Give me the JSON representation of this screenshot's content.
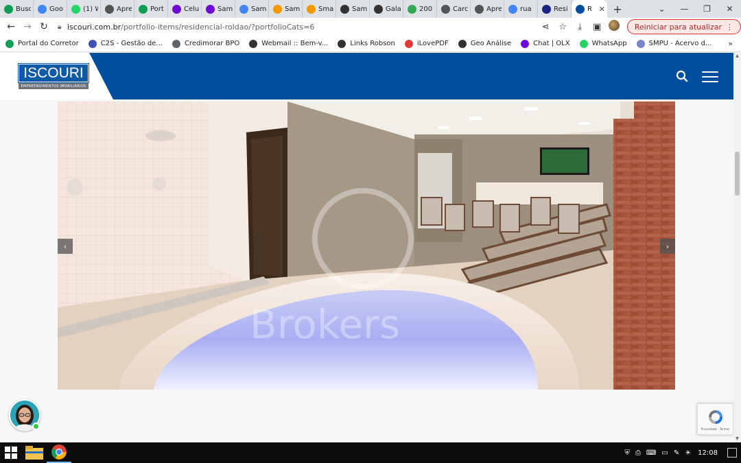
{
  "browser": {
    "tabs": [
      {
        "label": "Busc",
        "icon": "green-circle-icon",
        "color": "#0f9d58"
      },
      {
        "label": "Goo",
        "icon": "google-icon",
        "color": "#4285f4"
      },
      {
        "label": "(1) W",
        "icon": "whatsapp-icon",
        "color": "#25d366"
      },
      {
        "label": "Apre",
        "icon": "globe-icon",
        "color": "#555555"
      },
      {
        "label": "Port",
        "icon": "green-circle-icon",
        "color": "#0f9d58"
      },
      {
        "label": "Celu",
        "icon": "olx-icon",
        "color": "#6e0ad6"
      },
      {
        "label": "Sam",
        "icon": "olx-icon",
        "color": "#6e0ad6"
      },
      {
        "label": "Sam",
        "icon": "google-icon",
        "color": "#4285f4"
      },
      {
        "label": "Sam",
        "icon": "orange-circle-icon",
        "color": "#f29900"
      },
      {
        "label": "Sma",
        "icon": "orange-circle-icon",
        "color": "#f29900"
      },
      {
        "label": "Sam",
        "icon": "gc-icon",
        "color": "#333333"
      },
      {
        "label": "Gala",
        "icon": "gc-icon",
        "color": "#333333"
      },
      {
        "label": "200",
        "icon": "map-pin-icon",
        "color": "#34a853"
      },
      {
        "label": "Carc",
        "icon": "globe-icon",
        "color": "#555555"
      },
      {
        "label": "Apre",
        "icon": "globe-icon",
        "color": "#555555"
      },
      {
        "label": "rua",
        "icon": "google-icon",
        "color": "#4285f4"
      },
      {
        "label": "Resi",
        "icon": "link-icon",
        "color": "#1a237e"
      },
      {
        "label": "R",
        "icon": "site-icon",
        "color": "#004f9e"
      }
    ],
    "new_tab": "+",
    "url_host": "iscouri.com.br",
    "url_path": "/portfolio-items/residencial-roldao/?portfolioCats=6",
    "update_button": "Reiniciar para atualizar",
    "bookmarks": [
      {
        "label": "Portal do Corretor",
        "icon": "green-circle-icon",
        "color": "#0f9d58"
      },
      {
        "label": "C2S - Gestão de...",
        "icon": "c2s-icon",
        "color": "#3f51b5"
      },
      {
        "label": "Credimorar BPO",
        "icon": "document-icon",
        "color": "#5f6368"
      },
      {
        "label": "Webmail :: Bem-v...",
        "icon": "globe-icon",
        "color": "#333333"
      },
      {
        "label": "Links Robson",
        "icon": "globe-icon",
        "color": "#333333"
      },
      {
        "label": "iLovePDF",
        "icon": "heart-icon",
        "color": "#e53935"
      },
      {
        "label": "Geo Análise",
        "icon": "globe-icon",
        "color": "#333333"
      },
      {
        "label": "Chat | OLX",
        "icon": "olx-icon",
        "color": "#6e0ad6"
      },
      {
        "label": "WhatsApp",
        "icon": "whatsapp-icon",
        "color": "#25d366"
      },
      {
        "label": "SMPU - Acervo d...",
        "icon": "building-icon",
        "color": "#7986cb"
      }
    ]
  },
  "site": {
    "logo_text": "ISCOURI",
    "logo_subtitle": "EMPREENDIMENTOS IMOBILIÁRIOS",
    "header_color": "#004f9e",
    "watermark": "Brokers",
    "prev_arrow": "‹",
    "next_arrow": "›",
    "recaptcha_text": "Privacidade - Termos"
  },
  "taskbar": {
    "time": "12:08"
  }
}
